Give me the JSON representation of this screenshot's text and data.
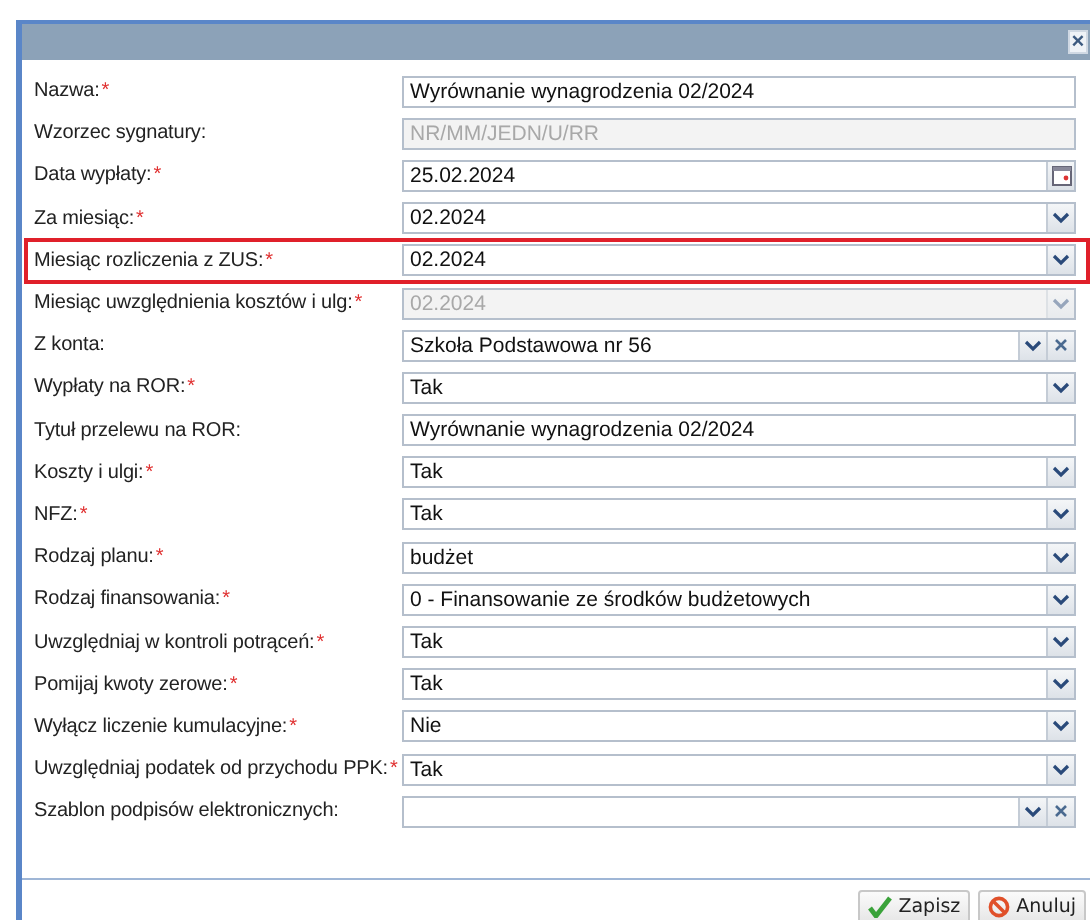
{
  "dialog": {
    "close": "×"
  },
  "fields": [
    {
      "label": "Nazwa:",
      "required_mark": "*",
      "kind": "text",
      "value": "Wyrównanie wynagrodzenia 02/2024",
      "disabled": false,
      "highlighted": false
    },
    {
      "label": "Wzorzec sygnatury:",
      "kind": "text",
      "value": "NR/MM/JEDN/U/RR",
      "disabled": true,
      "highlighted": false
    },
    {
      "label": "Data wypłaty:",
      "required_mark": "*",
      "kind": "date",
      "value": "25.02.2024",
      "disabled": false,
      "highlighted": false
    },
    {
      "label": "Za miesiąc:",
      "required_mark": "*",
      "kind": "combo",
      "value": "02.2024",
      "disabled": false,
      "highlighted": false
    },
    {
      "label": "Miesiąc rozliczenia z ZUS:",
      "required_mark": "*",
      "kind": "combo",
      "value": "02.2024",
      "disabled": false,
      "highlighted": true
    },
    {
      "label": "Miesiąc uwzględnienia kosztów i ulg:",
      "required_mark": "*",
      "kind": "combo",
      "value": "02.2024",
      "disabled": true,
      "highlighted": false
    },
    {
      "label": "Z konta:",
      "kind": "combo-clear",
      "value": "Szkoła Podstawowa nr 56",
      "disabled": false,
      "highlighted": false
    },
    {
      "label": "Wypłaty na ROR:",
      "required_mark": "*",
      "kind": "combo",
      "value": "Tak",
      "disabled": false,
      "highlighted": false
    },
    {
      "label": "Tytuł przelewu na ROR:",
      "kind": "text",
      "value": "Wyrównanie wynagrodzenia 02/2024",
      "disabled": false,
      "highlighted": false
    },
    {
      "label": "Koszty i ulgi:",
      "required_mark": "*",
      "kind": "combo",
      "value": "Tak",
      "disabled": false,
      "highlighted": false
    },
    {
      "label": "NFZ:",
      "required_mark": "*",
      "kind": "combo",
      "value": "Tak",
      "disabled": false,
      "highlighted": false
    },
    {
      "label": "Rodzaj planu:",
      "required_mark": "*",
      "kind": "combo",
      "value": "budżet",
      "disabled": false,
      "highlighted": false
    },
    {
      "label": "Rodzaj finansowania:",
      "required_mark": "*",
      "kind": "combo",
      "value": "0 - Finansowanie ze środków budżetowych",
      "disabled": false,
      "highlighted": false
    },
    {
      "label": "Uwzględniaj w kontroli potrąceń:",
      "required_mark": "*",
      "kind": "combo",
      "value": "Tak",
      "disabled": false,
      "highlighted": false
    },
    {
      "label": "Pomijaj kwoty zerowe:",
      "required_mark": "*",
      "kind": "combo",
      "value": "Tak",
      "disabled": false,
      "highlighted": false
    },
    {
      "label": "Wyłącz liczenie kumulacyjne:",
      "required_mark": "*",
      "kind": "combo",
      "value": "Nie",
      "disabled": false,
      "highlighted": false
    },
    {
      "label": "Uwzględniaj podatek od przychodu PPK:",
      "required_mark": "*",
      "kind": "combo",
      "value": "Tak",
      "disabled": false,
      "highlighted": false
    },
    {
      "label": "Szablon podpisów elektronicznych:",
      "kind": "combo-clear",
      "disabled": false,
      "highlighted": false
    }
  ],
  "buttons": [
    {
      "label": "Zapisz",
      "kind": "save"
    },
    {
      "label": "Anuluj",
      "kind": "cancel"
    }
  ]
}
